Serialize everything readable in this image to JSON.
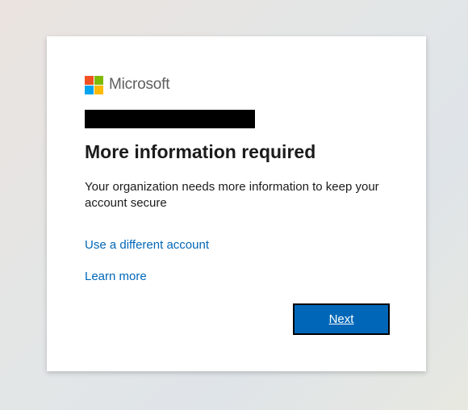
{
  "brand": {
    "name": "Microsoft",
    "logo_colors": [
      "#f25022",
      "#7fba00",
      "#00a4ef",
      "#ffb900"
    ]
  },
  "account": {
    "redacted_text": ""
  },
  "heading": "More information required",
  "description": "Your organization needs more information to keep your account secure",
  "links": {
    "different_account": "Use a different account",
    "learn_more": "Learn more"
  },
  "buttons": {
    "next": "Next"
  },
  "colors": {
    "link": "#0067b8",
    "primary_button": "#0067b8"
  }
}
